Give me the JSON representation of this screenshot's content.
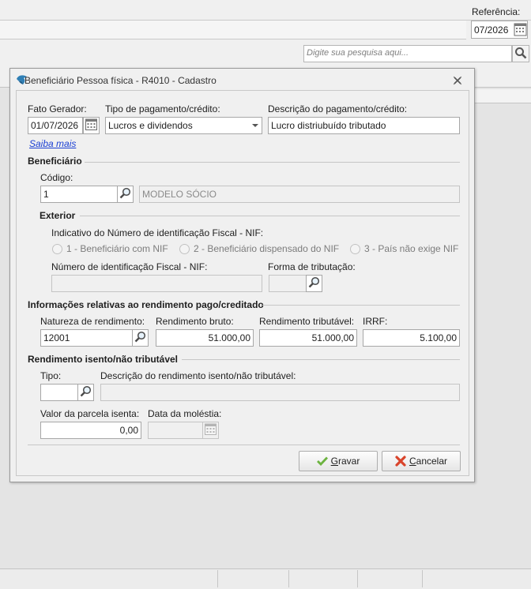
{
  "background": {
    "reference_label": "Referência:",
    "reference_value": "07/2026",
    "search_placeholder": "Digite sua pesquisa aqui..."
  },
  "dialog": {
    "title": "Beneficiário Pessoa física - R4010 - Cadastro",
    "fato_gerador_label": "Fato Gerador:",
    "fato_gerador_value": "01/07/2026",
    "tipo_pagamento_label": "Tipo de pagamento/crédito:",
    "tipo_pagamento_value": "Lucros e dividendos",
    "descricao_label": "Descrição do pagamento/crédito:",
    "descricao_value": "Lucro distriubuído tributado",
    "saiba_mais": "Saiba mais",
    "beneficiario": {
      "section": "Beneficiário",
      "codigo_label": "Código:",
      "codigo_value": "1",
      "nome_value": "MODELO SÓCIO"
    },
    "exterior": {
      "section": "Exterior",
      "nif_indicativo_label": "Indicativo do Número de identificação Fiscal - NIF:",
      "radio_options": [
        "1 - Beneficiário com NIF",
        "2 - Beneficiário dispensado do NIF",
        "3 - País não exige NIF"
      ],
      "nif_numero_label": "Número de identificação Fiscal - NIF:",
      "forma_tributacao_label": "Forma de tributação:"
    },
    "rendimento": {
      "section": "Informações relativas ao rendimento pago/creditado",
      "natureza_label": "Natureza de rendimento:",
      "natureza_value": "12001",
      "bruto_label": "Rendimento bruto:",
      "bruto_value": "51.000,00",
      "tributavel_label": "Rendimento tributável:",
      "tributavel_value": "51.000,00",
      "irrf_label": "IRRF:",
      "irrf_value": "5.100,00"
    },
    "isento": {
      "section": "Rendimento isento/não tributável",
      "tipo_label": "Tipo:",
      "descricao_label": "Descrição do rendimento isento/não tributável:",
      "valor_parcela_label": "Valor da parcela isenta:",
      "valor_parcela_value": "0,00",
      "data_molestia_label": "Data da moléstia:"
    },
    "buttons": {
      "gravar_first": "G",
      "gravar_rest": "ravar",
      "cancelar_first": "C",
      "cancelar_rest": "ancelar"
    }
  },
  "colors": {
    "accept_green": "#6cb33f",
    "cancel_red": "#d9442b",
    "link_blue": "#1a3fd3"
  }
}
